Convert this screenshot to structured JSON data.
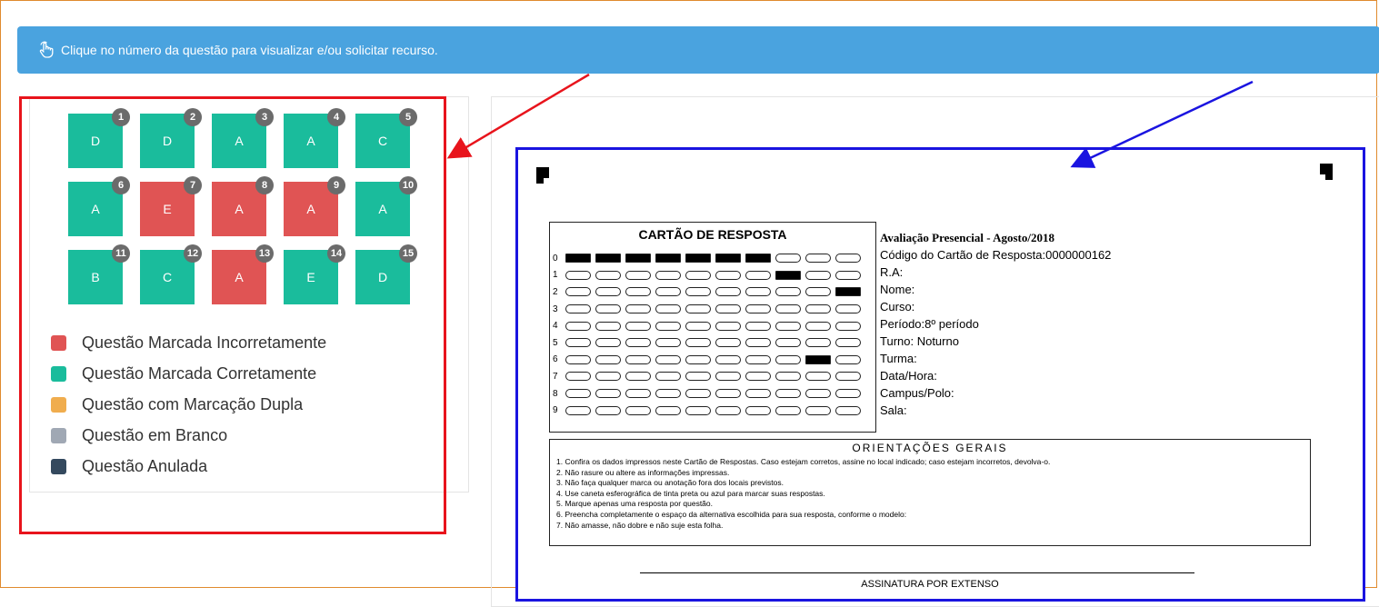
{
  "banner": {
    "icon": "pointer-hand-icon",
    "text": "Clique no número da questão para visualizar e/ou solicitar recurso."
  },
  "colors": {
    "correct": "#1abc9c",
    "incorrect": "#e05454",
    "double": "#f0ad4e",
    "blank": "#a0a8b4",
    "annulled": "#34495e",
    "banner": "#4aa3df",
    "highlight_red": "#e8141c",
    "highlight_blue": "#1a14e0"
  },
  "questions": [
    {
      "number": "1",
      "answer": "D",
      "status": "correct"
    },
    {
      "number": "2",
      "answer": "D",
      "status": "correct"
    },
    {
      "number": "3",
      "answer": "A",
      "status": "correct"
    },
    {
      "number": "4",
      "answer": "A",
      "status": "correct"
    },
    {
      "number": "5",
      "answer": "C",
      "status": "correct"
    },
    {
      "number": "6",
      "answer": "A",
      "status": "correct"
    },
    {
      "number": "7",
      "answer": "E",
      "status": "incorrect"
    },
    {
      "number": "8",
      "answer": "A",
      "status": "incorrect"
    },
    {
      "number": "9",
      "answer": "A",
      "status": "incorrect"
    },
    {
      "number": "10",
      "answer": "A",
      "status": "correct"
    },
    {
      "number": "11",
      "answer": "B",
      "status": "correct"
    },
    {
      "number": "12",
      "answer": "C",
      "status": "correct"
    },
    {
      "number": "13",
      "answer": "A",
      "status": "incorrect"
    },
    {
      "number": "14",
      "answer": "E",
      "status": "correct"
    },
    {
      "number": "15",
      "answer": "D",
      "status": "correct"
    }
  ],
  "legend": [
    {
      "label": "Questão Marcada Incorretamente",
      "status": "incorrect"
    },
    {
      "label": "Questão Marcada Corretamente",
      "status": "correct"
    },
    {
      "label": "Questão com Marcação Dupla",
      "status": "double"
    },
    {
      "label": "Questão em Branco",
      "status": "blank"
    },
    {
      "label": "Questão Anulada",
      "status": "annulled"
    }
  ],
  "card": {
    "title": "CARTÃO DE RESPOSTA",
    "row_numbers": [
      "0",
      "1",
      "2",
      "3",
      "4",
      "5",
      "6",
      "7",
      "8",
      "9"
    ],
    "filled": {
      "0": [
        0,
        1,
        2,
        3,
        4,
        5,
        6
      ],
      "1": [
        7
      ],
      "2": [
        9
      ],
      "6": [
        8
      ]
    },
    "info": {
      "evaluation": "Avaliação Presencial - Agosto/2018",
      "code": "Código do Cartão de Resposta:0000000162",
      "ra": "R.A:",
      "name": "Nome:",
      "course": "Curso:",
      "period": "Período:8º período",
      "shift": "Turno: Noturno",
      "class": "Turma:",
      "datetime": "Data/Hora:",
      "campus": "Campus/Polo:",
      "room": "Sala:"
    },
    "orientations_title": "ORIENTAÇÕES GERAIS",
    "orientations": [
      "1.  Confira os dados impressos neste Cartão de Respostas. Caso estejam corretos, assine no local indicado; caso estejam incorretos, devolva-o.",
      "2.  Não rasure ou altere as informações impressas.",
      "3.  Não faça qualquer marca ou anotação fora dos locais previstos.",
      "4.  Use caneta esferográfica de tinta preta ou azul para marcar suas respostas.",
      "5.  Marque apenas uma resposta por questão.",
      "6.  Preencha completamente o espaço da alternativa escolhida para sua resposta, conforme o modelo:",
      "7.  Não amasse, não dobre e não suje esta folha."
    ],
    "signature_label": "ASSINATURA POR EXTENSO"
  }
}
